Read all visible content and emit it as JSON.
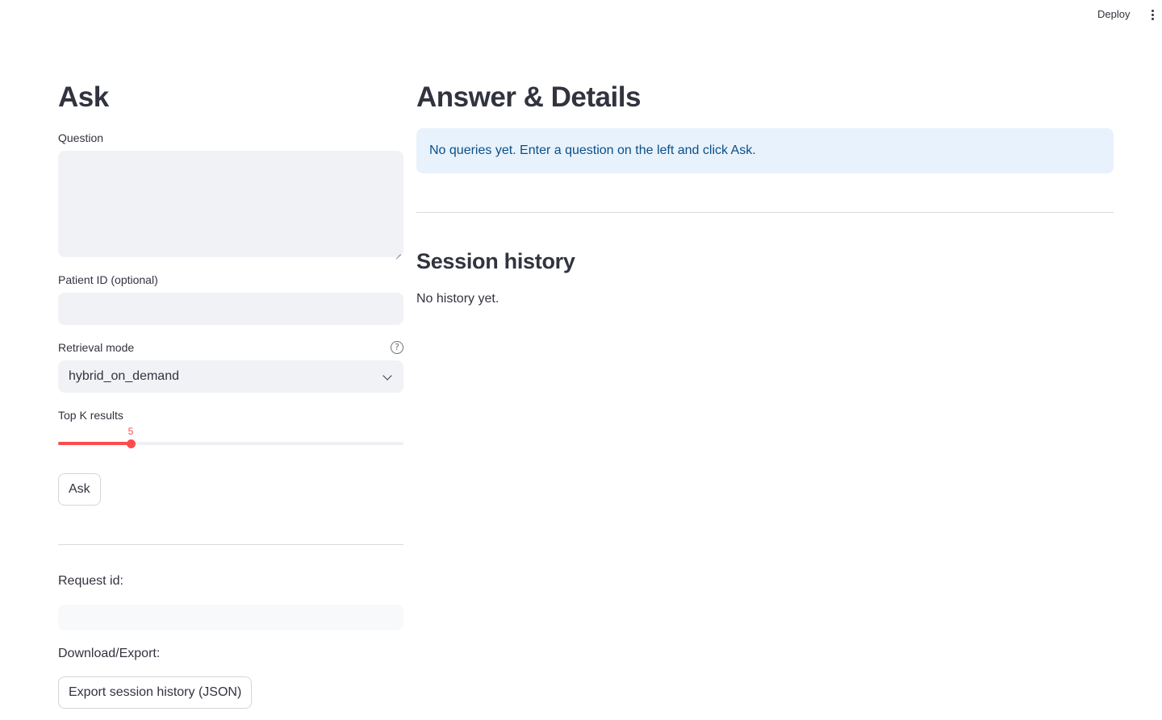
{
  "topbar": {
    "deploy_label": "Deploy",
    "menu_icon": "more-vertical-icon"
  },
  "left": {
    "title": "Ask",
    "question": {
      "label": "Question",
      "value": ""
    },
    "patient_id": {
      "label": "Patient ID (optional)",
      "value": ""
    },
    "retrieval_mode": {
      "label": "Retrieval mode",
      "help_icon": "help-circle-icon",
      "help_glyph": "?",
      "selected": "hybrid_on_demand"
    },
    "top_k": {
      "label": "Top K results",
      "value": 5,
      "value_text": "5",
      "min": 1,
      "max": 20,
      "accent": "#ff4b4b"
    },
    "ask_button": "Ask",
    "request_id": {
      "label": "Request id:",
      "value": ""
    },
    "download_label": "Download/Export:",
    "export_button": "Export session history (JSON)"
  },
  "right": {
    "title": "Answer & Details",
    "info_message": "No queries yet. Enter a question on the left and click Ask.",
    "history_title": "Session history",
    "history_empty": "No history yet."
  },
  "colors": {
    "accent": "#ff4b4b",
    "input_bg": "#f0f2f6",
    "info_bg": "#e8f2fc",
    "info_text": "#0b4f86",
    "text": "#31333f"
  }
}
